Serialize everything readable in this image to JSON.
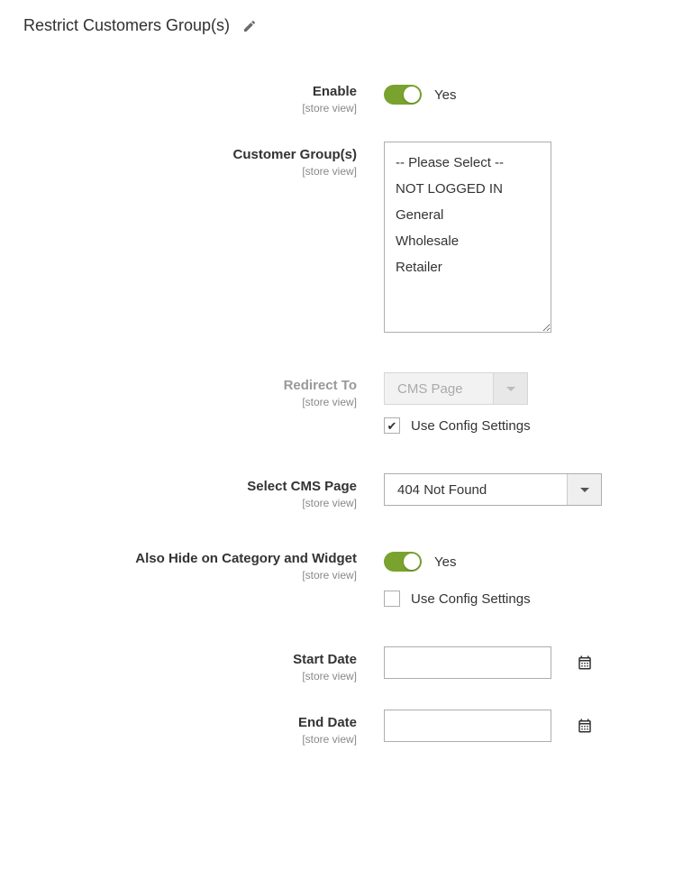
{
  "section": {
    "title": "Restrict Customers Group(s)",
    "edit_icon": "pencil-icon"
  },
  "scope_text": "[store view]",
  "fields": {
    "enable": {
      "label": "Enable",
      "value_text": "Yes",
      "checked": true
    },
    "customer_groups": {
      "label": "Customer Group(s)",
      "options": [
        "-- Please Select --",
        "NOT LOGGED IN",
        "General",
        "Wholesale",
        "Retailer"
      ]
    },
    "redirect_to": {
      "label": "Redirect To",
      "value": "CMS Page",
      "use_config": {
        "checked": true,
        "label": "Use Config Settings"
      }
    },
    "select_cms_page": {
      "label": "Select CMS Page",
      "value": "404 Not Found"
    },
    "also_hide": {
      "label": "Also Hide on Category and Widget",
      "value_text": "Yes",
      "checked": true,
      "use_config": {
        "checked": false,
        "label": "Use Config Settings"
      }
    },
    "start_date": {
      "label": "Start Date",
      "value": ""
    },
    "end_date": {
      "label": "End Date",
      "value": ""
    }
  }
}
